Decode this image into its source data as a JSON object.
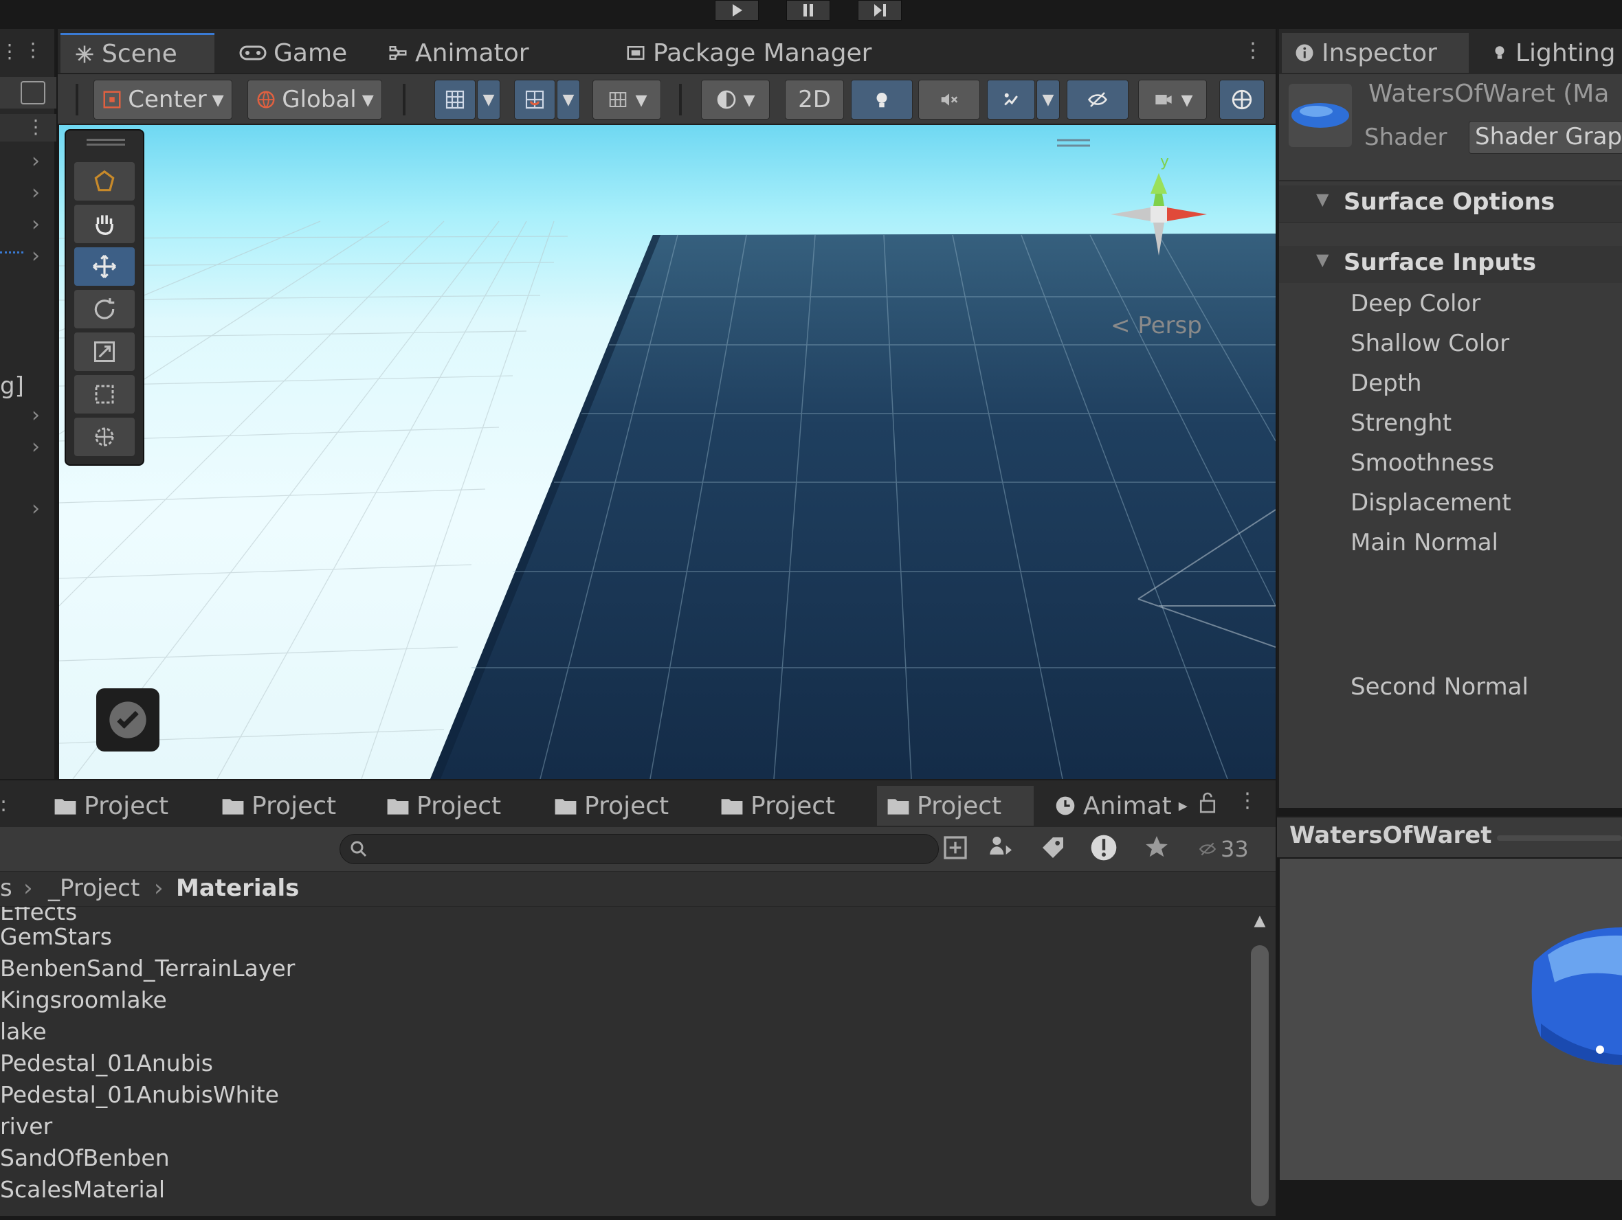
{
  "playbar": {
    "buttons": [
      "play-icon",
      "pause-icon",
      "step-icon"
    ]
  },
  "scene_tabs": [
    {
      "label": "Scene",
      "icon": "scene-grid-icon",
      "active": true
    },
    {
      "label": "Game",
      "icon": "gamepad-icon",
      "active": false
    },
    {
      "label": "Animator",
      "icon": "animator-icon",
      "active": false
    },
    {
      "label": "Package Manager",
      "icon": "package-icon",
      "active": false
    }
  ],
  "toolbar": {
    "pivot_label": "Center",
    "space_label": "Global",
    "mode_2d": "2D"
  },
  "viewport": {
    "projection_label": "< Persp",
    "gizmo_axis_label": "y"
  },
  "inspector": {
    "tabs": [
      {
        "label": "Inspector",
        "icon": "info-icon"
      },
      {
        "label": "Lighting",
        "icon": "lightbulb-icon"
      }
    ],
    "material_name": "WatersOfWaret (Ma",
    "shader_label": "Shader",
    "shader_value": "Shader Grap",
    "sections": [
      "Surface Options",
      "Surface Inputs"
    ],
    "properties": [
      "Deep Color",
      "Shallow Color",
      "Depth",
      "Strenght",
      "Smoothness",
      "Displacement",
      "Main Normal",
      "Second Normal"
    ]
  },
  "project_tabs": [
    {
      "label": "Project",
      "active": false
    },
    {
      "label": "Project",
      "active": false
    },
    {
      "label": "Project",
      "active": false
    },
    {
      "label": "Project",
      "active": false
    },
    {
      "label": "Project",
      "active": false
    },
    {
      "label": "Project",
      "active": true
    },
    {
      "label": "Animat",
      "active": false
    }
  ],
  "project_toolbar": {
    "search_placeholder": "",
    "hidden_count": "33"
  },
  "breadcrumb": [
    "s",
    "_Project",
    "Materials"
  ],
  "files": [
    "Effects",
    "GemStars",
    "BenbenSand_TerrainLayer",
    "Kingsroomlake",
    "lake",
    "Pedestal_01Anubis",
    "Pedestal_01AnubisWhite",
    "river",
    "SandOfBenben",
    "ScalesMaterial"
  ],
  "preview": {
    "title": "WatersOfWaret"
  },
  "left_panel": {
    "label": "g]"
  },
  "colors": {
    "accent": "#3a7bd5",
    "water": "#1e3e5e",
    "sky": "#aaf0fb"
  }
}
